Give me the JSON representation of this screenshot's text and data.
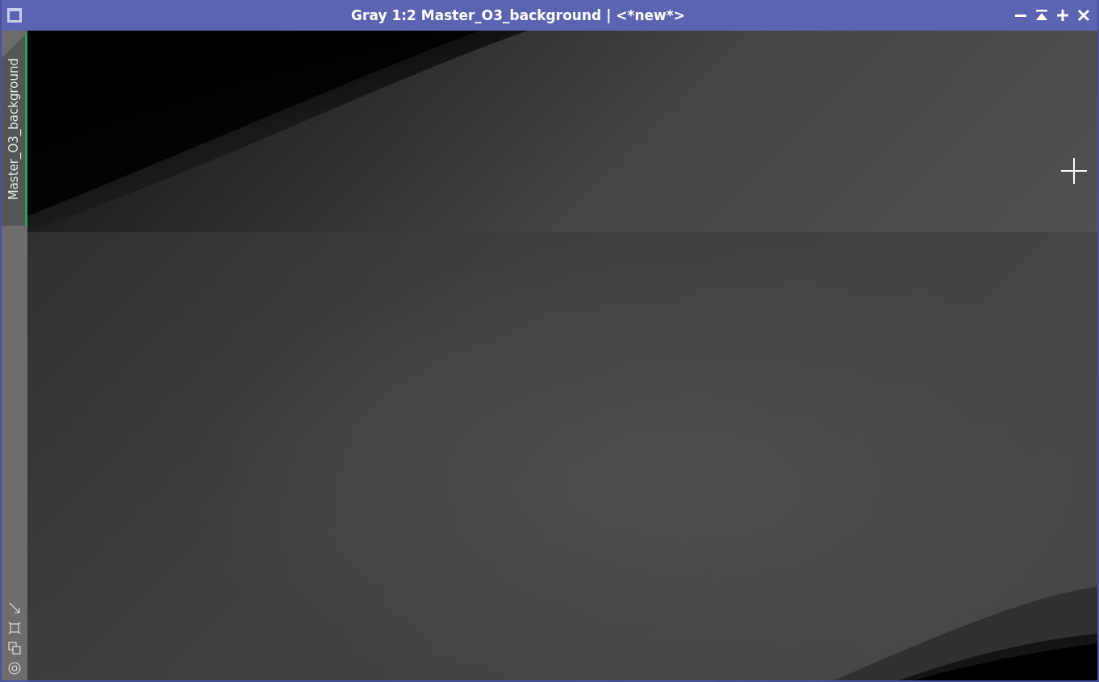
{
  "window": {
    "title": "Gray 1:2 Master_O3_background | <*new*>"
  },
  "view_tabs": [
    {
      "label": "Master_O3_background",
      "selected": true
    }
  ]
}
